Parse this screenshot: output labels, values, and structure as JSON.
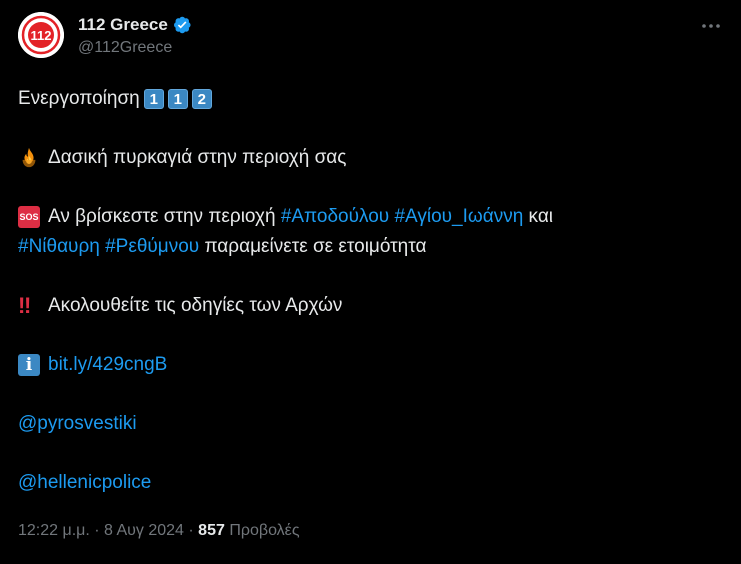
{
  "account": {
    "display_name": "112 Greece",
    "handle": "@112Greece",
    "avatar_label": "112",
    "verified": true
  },
  "colors": {
    "background": "#000000",
    "text": "#e7e9ea",
    "secondary_text": "#71767b",
    "link": "#1d9bf0",
    "verified_badge": "#1d9bf0",
    "avatar_red": "#e32227"
  },
  "icons": {
    "verified": "verified-badge-icon",
    "more": "more-options-icon",
    "fire": "fire-icon",
    "sos": "sos-icon",
    "double_exclamation": "double-exclamation-icon",
    "info": "information-icon"
  },
  "tweet": {
    "line1_text": "Ενεργοποίηση",
    "keycaps": [
      "1",
      "1",
      "2"
    ],
    "line2_text": "Δασική πυρκαγιά στην περιοχή σας",
    "sos_label": "SOS",
    "line3_text": "Αν βρίσκεστε στην περιοχή",
    "hashtag1": "#Αποδούλου",
    "hashtag2": "#Αγίου_Ιωάννη",
    "and_text": "και",
    "hashtag3": "#Νίθαυρη",
    "hashtag4": "#Ρεθύμνου",
    "line4_text": "παραμείνετε σε ετοιμότητα",
    "bang_label": "‼",
    "line5_text": "Ακολουθείτε τις οδηγίες των Αρχών",
    "info_label": "i",
    "link_text": "bit.ly/429cngB",
    "mention1": "@pyrosvestiki",
    "mention2": "@hellenicpolice"
  },
  "meta": {
    "time": "12:22 μ.μ.",
    "separator": " · ",
    "date": "8 Αυγ 2024",
    "views_count": "857",
    "views_label": "Προβολές"
  }
}
